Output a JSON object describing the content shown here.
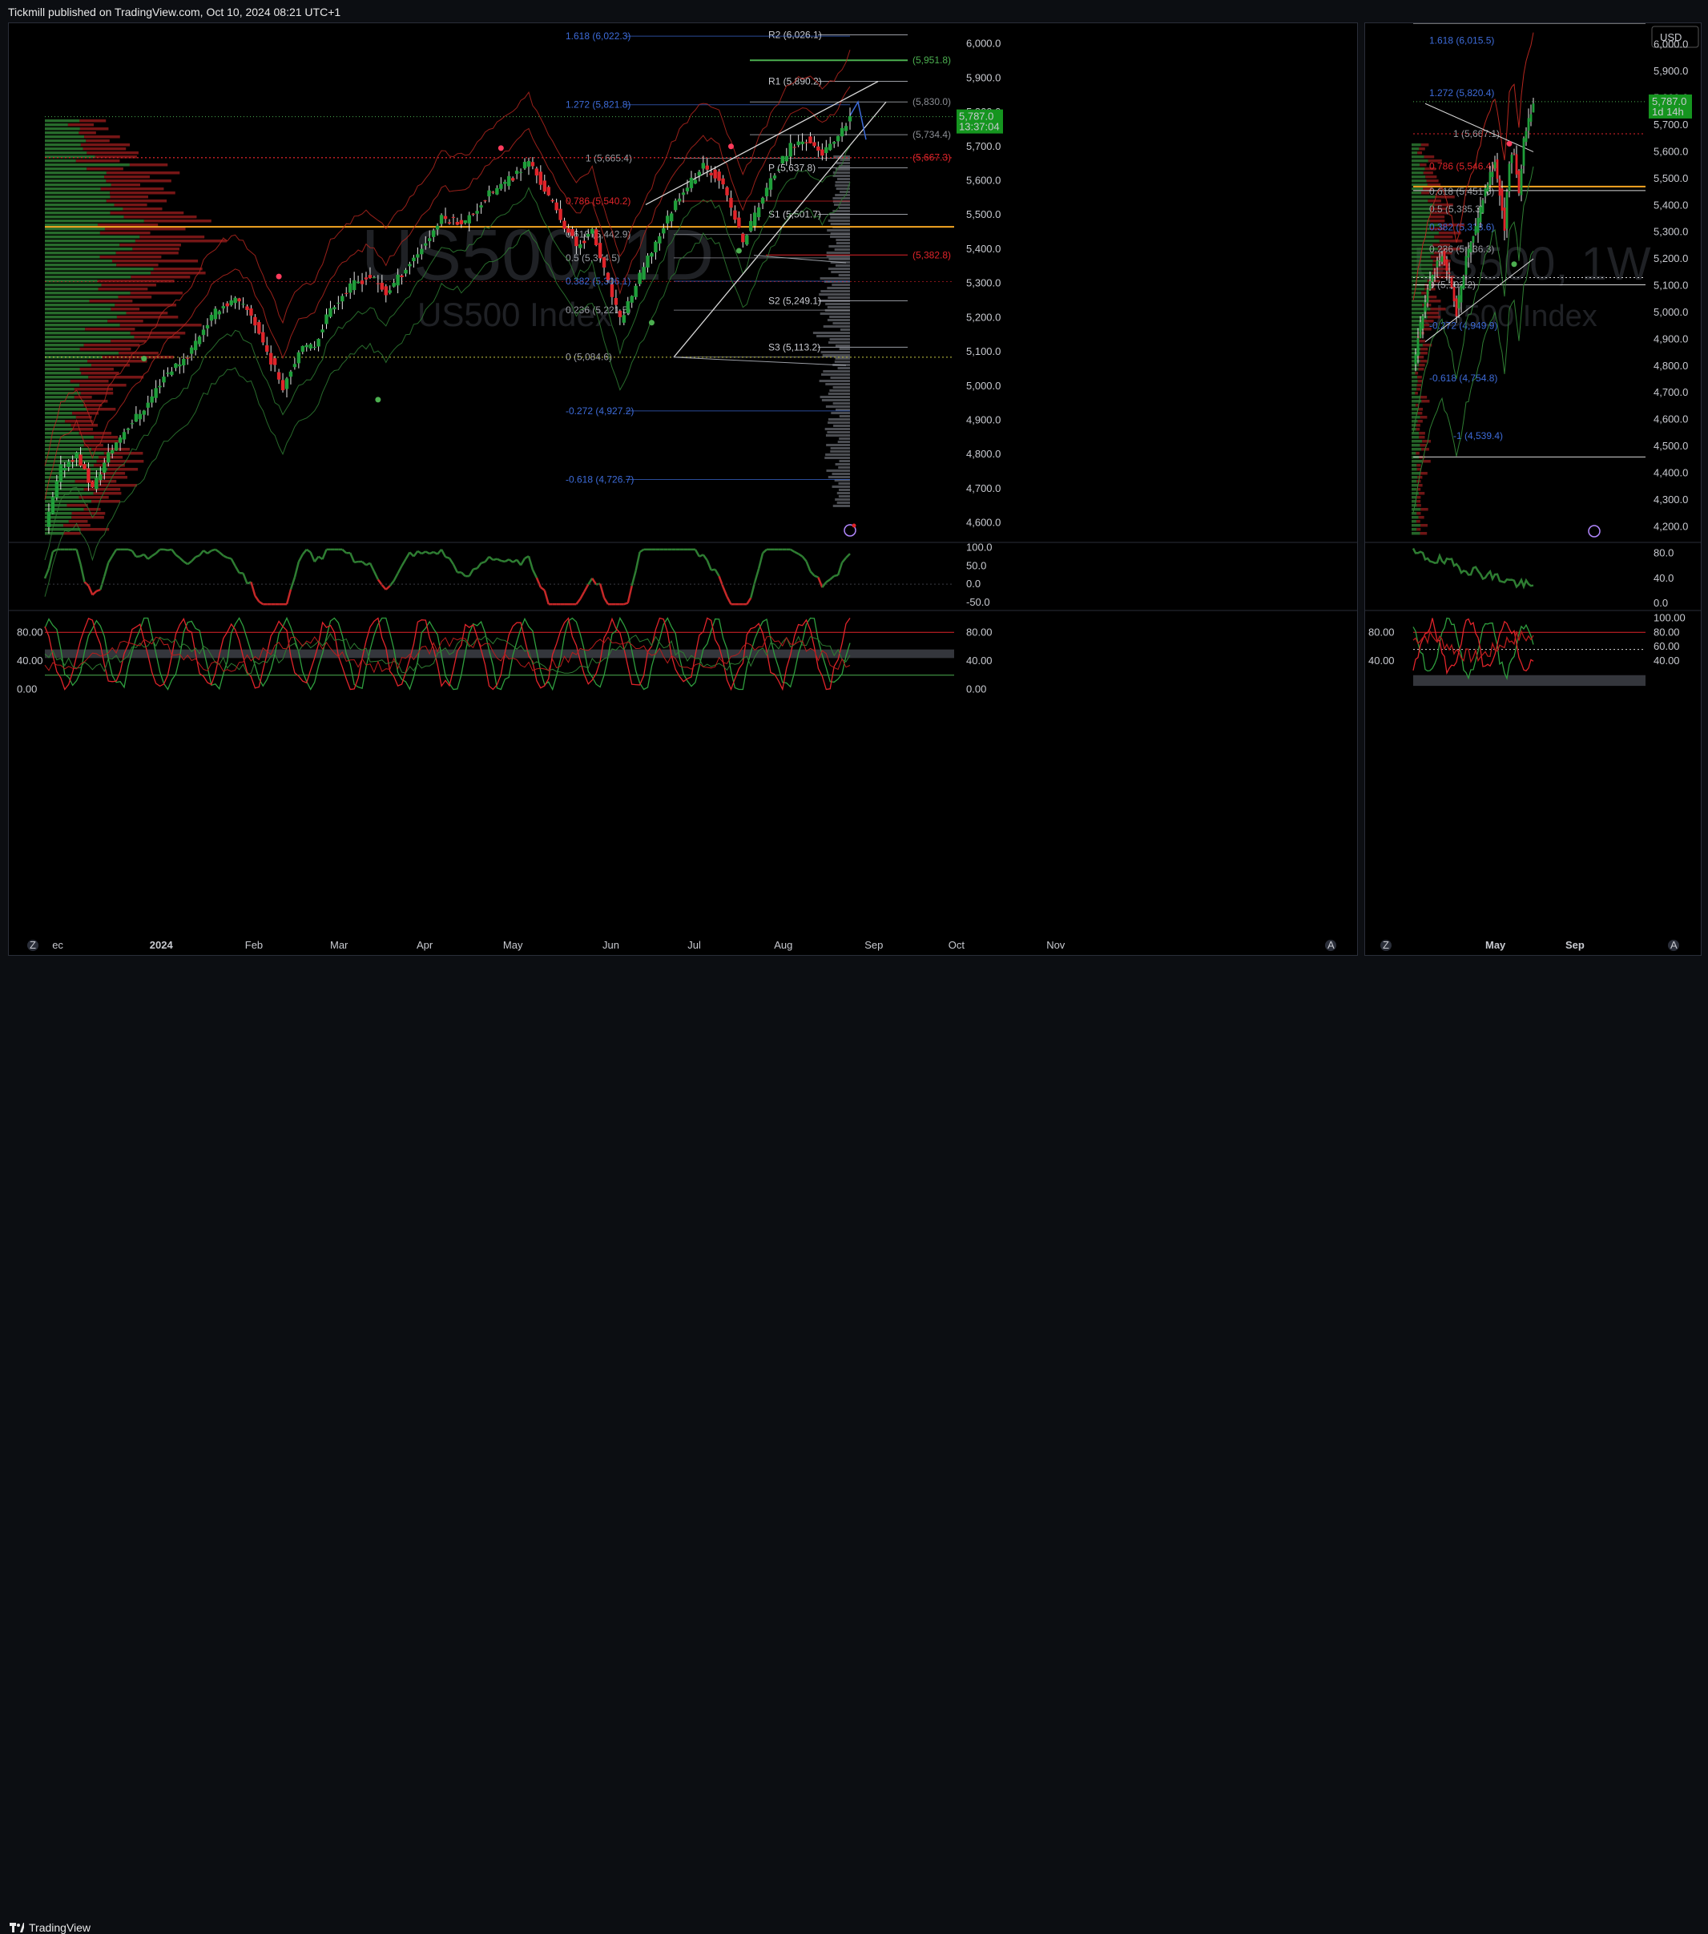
{
  "header": {
    "published": "Tickmill published on TradingView.com, Oct 10, 2024 08:21 UTC+1"
  },
  "footer": {
    "brand": "TradingView"
  },
  "colors": {
    "bull": "#1f9e3a",
    "bear": "#e0242a",
    "fib": "#3d6bd8",
    "pivot": "#b0b3ba",
    "orange": "#f5a623",
    "green_line": "#4caf50",
    "price_tag": "#15951f"
  },
  "left_chart": {
    "watermark_symbol": "US500, 1D",
    "watermark_desc": "US500 Index",
    "price_axis": [
      "6,000.0",
      "5,900.0",
      "5,800.0",
      "5,700.0",
      "5,600.0",
      "5,500.0",
      "5,400.0",
      "5,300.0",
      "5,200.0",
      "5,100.0",
      "5,000.0",
      "4,900.0",
      "4,800.0",
      "4,700.0",
      "4,600.0"
    ],
    "price_tag": {
      "price": "5,787.0",
      "countdown": "13:37:04"
    },
    "time_axis": [
      "ec",
      "2024",
      "Feb",
      "Mar",
      "Apr",
      "May",
      "Jun",
      "Jul",
      "Aug",
      "Sep",
      "Oct",
      "Nov"
    ],
    "fib_labels": [
      "1.618 (6,022.3)",
      "1.272 (5,821.8)",
      "1 (5,665.4)",
      "0.786 (5,540.2)",
      "0.618 (5,442.9)",
      "0.5 (5,374.5)",
      "0.382 (5,306.1)",
      "0.236 (5,221.5)",
      "0 (5,084.6)",
      "-0.272 (4,927.2)",
      "-0.618 (4,726.7)"
    ],
    "pivot_labels": [
      "R2 (6,026.1)",
      "R1 (5,890.2)",
      "P (5,637.8)",
      "S1 (5,501.7)",
      "S2 (5,249.1)",
      "S3 (5,113.2)"
    ],
    "side_labels": [
      "(5,951.8)",
      "(5,830.0)",
      "(5,734.4)",
      "(5,667.3)",
      "(5,382.8)"
    ],
    "osc1_axis": [
      "100.0",
      "50.0",
      "0.0",
      "-50.0"
    ],
    "osc2_axis_left": [
      "80.00",
      "40.00",
      "0.00"
    ],
    "osc2_axis_right": [
      "80.00",
      "40.00",
      "0.00"
    ],
    "corner_labels": {
      "z": "Z",
      "a": "A"
    }
  },
  "right_chart": {
    "currency": "USD",
    "watermark_symbol": "US500, 1W",
    "watermark_desc": "US500 Index",
    "price_axis": [
      "6,000.0",
      "5,900.0",
      "5,800.0",
      "5,700.0",
      "5,600.0",
      "5,500.0",
      "5,400.0",
      "5,300.0",
      "5,200.0",
      "5,100.0",
      "5,000.0",
      "4,900.0",
      "4,800.0",
      "4,700.0",
      "4,600.0",
      "4,500.0",
      "4,400.0",
      "4,300.0",
      "4,200.0"
    ],
    "price_tag": {
      "price": "5,787.0",
      "countdown": "1d 14h"
    },
    "time_axis": [
      "May",
      "Sep"
    ],
    "fib_labels": [
      "1.618 (6,015.5)",
      "1.272 (5,820.4)",
      "1 (5,667.1)",
      "0.786 (5,546.4)",
      "0.618 (5,451.6)",
      "0.5 (5,385.3)",
      "0.382 (5,318.6)",
      "0.236 (5,236.3)",
      "0 (5,103.2)",
      "-0.272 (4,949.9)",
      "-0.618 (4,754.8)",
      "-1 (4,539.4)"
    ],
    "osc1_axis": [
      "80.0",
      "40.0",
      "0.0"
    ],
    "osc2_axis_left": [
      "80.00",
      "40.00"
    ],
    "osc2_axis_right": [
      "100.00",
      "80.00",
      "60.00",
      "40.00"
    ],
    "corner_labels": {
      "z": "Z",
      "a": "A"
    }
  },
  "chart_data": [
    {
      "type": "candlestick",
      "timeframe": "1D",
      "symbol": "US500",
      "description": "US500 Index",
      "x_range": [
        "2023-12",
        "2024-11"
      ],
      "ylim": [
        4550,
        6060
      ],
      "last_price": 5787.0,
      "close_path_approx": [
        [
          0,
          4580
        ],
        [
          4,
          4760
        ],
        [
          8,
          4800
        ],
        [
          12,
          4700
        ],
        [
          16,
          4800
        ],
        [
          20,
          4870
        ],
        [
          26,
          4950
        ],
        [
          30,
          5030
        ],
        [
          36,
          5090
        ],
        [
          40,
          5170
        ],
        [
          44,
          5230
        ],
        [
          48,
          5250
        ],
        [
          52,
          5210
        ],
        [
          56,
          5100
        ],
        [
          60,
          5000
        ],
        [
          64,
          5100
        ],
        [
          68,
          5120
        ],
        [
          72,
          5230
        ],
        [
          78,
          5300
        ],
        [
          82,
          5320
        ],
        [
          86,
          5270
        ],
        [
          90,
          5330
        ],
        [
          96,
          5420
        ],
        [
          100,
          5490
        ],
        [
          106,
          5480
        ],
        [
          112,
          5560
        ],
        [
          118,
          5610
        ],
        [
          122,
          5660
        ],
        [
          128,
          5530
        ],
        [
          134,
          5410
        ],
        [
          138,
          5450
        ],
        [
          142,
          5300
        ],
        [
          145,
          5190
        ],
        [
          150,
          5320
        ],
        [
          154,
          5420
        ],
        [
          160,
          5560
        ],
        [
          166,
          5640
        ],
        [
          170,
          5610
        ],
        [
          174,
          5490
        ],
        [
          176,
          5420
        ],
        [
          180,
          5530
        ],
        [
          184,
          5620
        ],
        [
          188,
          5700
        ],
        [
          192,
          5720
        ],
        [
          196,
          5680
        ],
        [
          200,
          5720
        ],
        [
          203,
          5787
        ]
      ],
      "fibonacci": [
        {
          "level": 1.618,
          "price": 6022.3
        },
        {
          "level": 1.272,
          "price": 5821.8
        },
        {
          "level": 1,
          "price": 5665.4
        },
        {
          "level": 0.786,
          "price": 5540.2
        },
        {
          "level": 0.618,
          "price": 5442.9
        },
        {
          "level": 0.5,
          "price": 5374.5
        },
        {
          "level": 0.382,
          "price": 5306.1
        },
        {
          "level": 0.236,
          "price": 5221.5
        },
        {
          "level": 0,
          "price": 5084.6
        },
        {
          "level": -0.272,
          "price": 4927.2
        },
        {
          "level": -0.618,
          "price": 4726.7
        }
      ],
      "pivots": [
        {
          "name": "R2",
          "price": 6026.1
        },
        {
          "name": "R1",
          "price": 5890.2
        },
        {
          "name": "P",
          "price": 5637.8
        },
        {
          "name": "S1",
          "price": 5501.7
        },
        {
          "name": "S2",
          "price": 5249.1
        },
        {
          "name": "S3",
          "price": 5113.2
        }
      ],
      "levels": [
        5951.8,
        5830.0,
        5734.4,
        5667.3,
        5382.8
      ],
      "poc_price": 5465,
      "oscillator1": {
        "ylim": [
          -70,
          110
        ],
        "axis": [
          100,
          50,
          0,
          -50
        ]
      },
      "oscillator2": {
        "ylim": [
          -5,
          105
        ],
        "axis": [
          80,
          40,
          0
        ],
        "bands": [
          20,
          80
        ]
      }
    },
    {
      "type": "candlestick",
      "timeframe": "1W",
      "symbol": "US500",
      "description": "US500 Index",
      "ylim": [
        4150,
        6080
      ],
      "last_price": 5787.0,
      "close_path_approx": [
        [
          0,
          4800
        ],
        [
          4,
          5000
        ],
        [
          8,
          5150
        ],
        [
          12,
          5220
        ],
        [
          16,
          5100
        ],
        [
          18,
          5000
        ],
        [
          22,
          5200
        ],
        [
          26,
          5310
        ],
        [
          30,
          5460
        ],
        [
          34,
          5560
        ],
        [
          36,
          5450
        ],
        [
          38,
          5320
        ],
        [
          40,
          5560
        ],
        [
          42,
          5600
        ],
        [
          44,
          5450
        ],
        [
          46,
          5650
        ],
        [
          50,
          5787
        ]
      ],
      "fibonacci": [
        {
          "level": 1.618,
          "price": 6015.5
        },
        {
          "level": 1.272,
          "price": 5820.4
        },
        {
          "level": 1,
          "price": 5667.1
        },
        {
          "level": 0.786,
          "price": 5546.4
        },
        {
          "level": 0.618,
          "price": 5451.6
        },
        {
          "level": 0.5,
          "price": 5385.3
        },
        {
          "level": 0.382,
          "price": 5318.6
        },
        {
          "level": 0.236,
          "price": 5236.3
        },
        {
          "level": 0,
          "price": 5103.2
        },
        {
          "level": -0.272,
          "price": 4949.9
        },
        {
          "level": -0.618,
          "price": 4754.8
        },
        {
          "level": -1,
          "price": 4539.4
        }
      ]
    }
  ]
}
